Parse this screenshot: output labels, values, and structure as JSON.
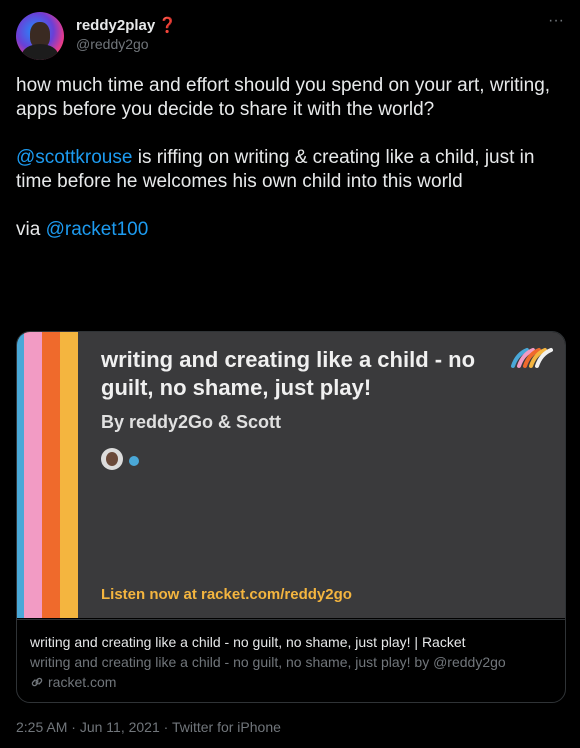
{
  "author": {
    "display_name": "reddy2play",
    "badge": "❓",
    "handle": "@reddy2go"
  },
  "tweet": {
    "line1": "how much time and effort should you spend on your art, writing, apps before you decide to share it with the world?",
    "mention1": "@scottkrouse",
    "line2_rest": " is riffing on writing & creating like a child, just in time before he welcomes his own child into this world",
    "via_prefix": "via ",
    "mention2": "@racket100"
  },
  "card": {
    "title": "writing and creating like a child - no guilt, no shame, just play!",
    "byline": "By reddy2Go & Scott",
    "listen": "Listen now at racket.com/reddy2go",
    "meta_title": "writing and creating like a child - no guilt, no shame, just play! | Racket",
    "meta_desc": "writing and creating like a child - no guilt, no shame, just play! by @reddy2go",
    "domain": "racket.com",
    "stripe_colors": [
      "#4aa8d8",
      "#f29bc4",
      "#ef6a2c",
      "#f4b53f"
    ]
  },
  "footer": {
    "time": "2:25 AM",
    "date": "Jun 11, 2021",
    "source": "Twitter for iPhone",
    "sep": " · "
  },
  "icons": {
    "more": "more-horizontal-icon",
    "link": "link-icon"
  }
}
